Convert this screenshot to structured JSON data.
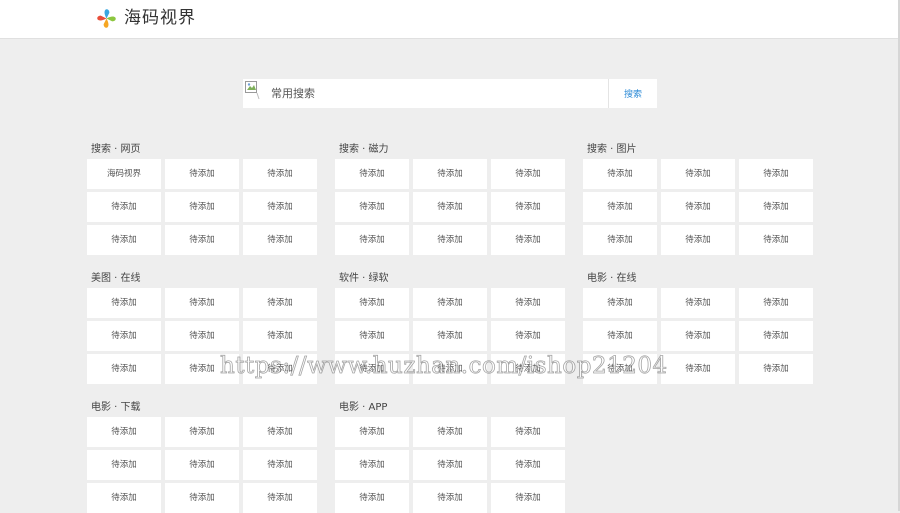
{
  "site": {
    "logo_text": "海码视界"
  },
  "search": {
    "placeholder": "常用搜索",
    "button_label": "搜索"
  },
  "sections": [
    {
      "title": "搜索 · 网页",
      "items": [
        "海码视界",
        "待添加",
        "待添加",
        "待添加",
        "待添加",
        "待添加",
        "待添加",
        "待添加",
        "待添加"
      ]
    },
    {
      "title": "搜索 · 磁力",
      "items": [
        "待添加",
        "待添加",
        "待添加",
        "待添加",
        "待添加",
        "待添加",
        "待添加",
        "待添加",
        "待添加"
      ]
    },
    {
      "title": "搜索 · 图片",
      "items": [
        "待添加",
        "待添加",
        "待添加",
        "待添加",
        "待添加",
        "待添加",
        "待添加",
        "待添加",
        "待添加"
      ]
    },
    {
      "title": "美图 · 在线",
      "items": [
        "待添加",
        "待添加",
        "待添加",
        "待添加",
        "待添加",
        "待添加",
        "待添加",
        "待添加",
        "待添加"
      ]
    },
    {
      "title": "软件 · 绿软",
      "items": [
        "待添加",
        "待添加",
        "待添加",
        "待添加",
        "待添加",
        "待添加",
        "待添加",
        "待添加",
        "待添加"
      ]
    },
    {
      "title": "电影 · 在线",
      "items": [
        "待添加",
        "待添加",
        "待添加",
        "待添加",
        "待添加",
        "待添加",
        "待添加",
        "待添加",
        "待添加"
      ]
    },
    {
      "title": "电影 · 下载",
      "items": [
        "待添加",
        "待添加",
        "待添加",
        "待添加",
        "待添加",
        "待添加",
        "待添加",
        "待添加",
        "待添加"
      ]
    },
    {
      "title": "电影 · APP",
      "items": [
        "待添加",
        "待添加",
        "待添加",
        "待添加",
        "待添加",
        "待添加",
        "待添加",
        "待添加",
        "待添加"
      ]
    }
  ],
  "watermark": "https://www.huzhan.com/ishop21204"
}
